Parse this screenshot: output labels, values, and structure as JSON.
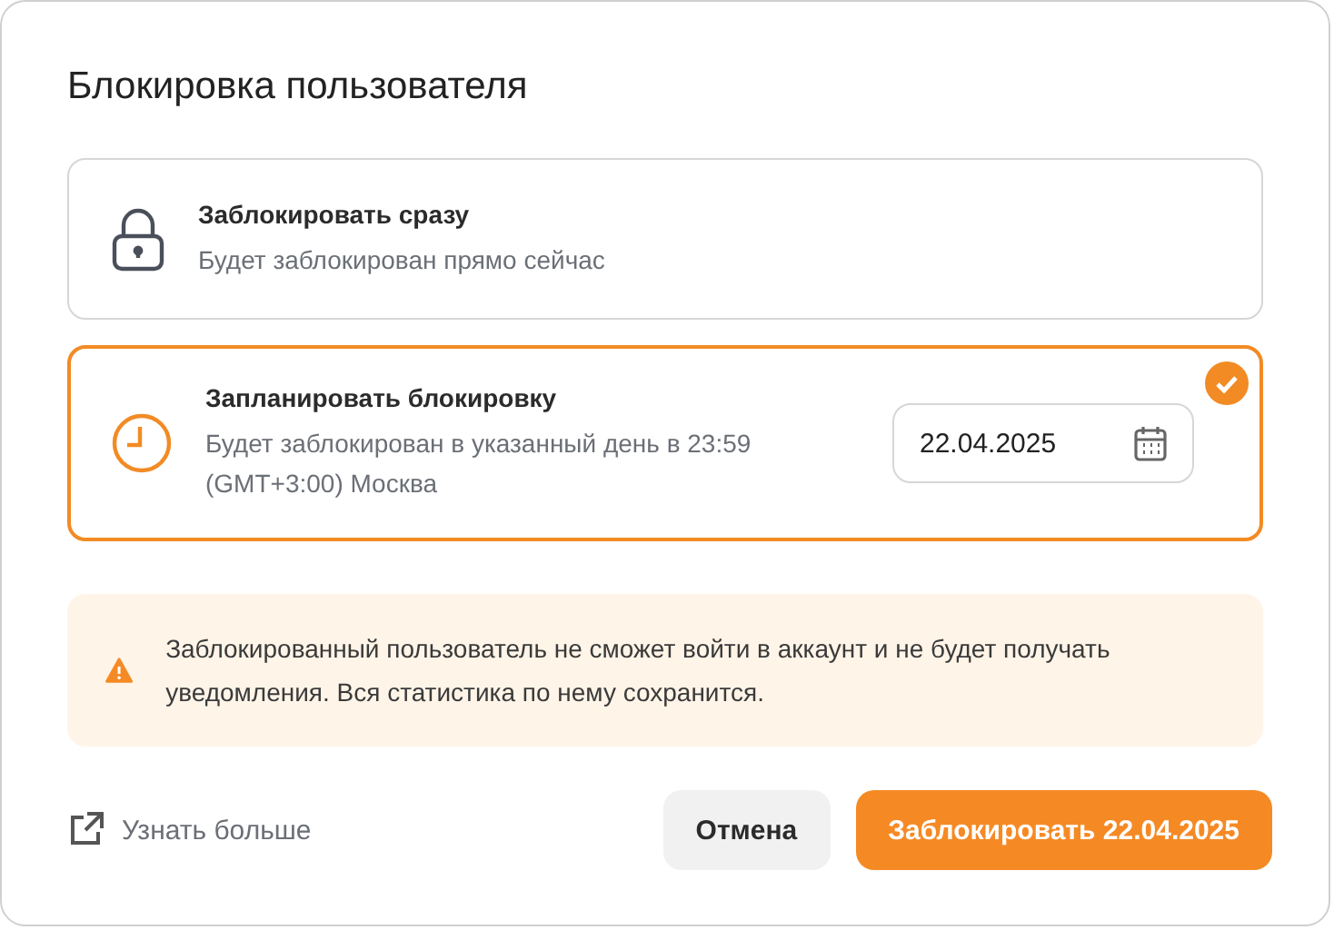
{
  "dialog": {
    "title": "Блокировка пользователя"
  },
  "options": [
    {
      "kind": "now",
      "title": "Заблокировать сразу",
      "description": "Будет заблокирован прямо сейчас",
      "selected": false
    },
    {
      "kind": "scheduled",
      "title": "Запланировать блокировку",
      "description": "Будет заблокирован в указанный день в 23:59 (GMT+3:00) Москва",
      "selected": true,
      "date": "22.04.2025"
    }
  ],
  "alert": {
    "text": "Заблокированный пользователь не сможет войти в аккаунт и не будет получать уведомления. Вся статистика по нему сохранится."
  },
  "footer": {
    "link": "Узнать больше",
    "cancel": "Отмена",
    "confirm": "Заблокировать 22.04.2025"
  }
}
